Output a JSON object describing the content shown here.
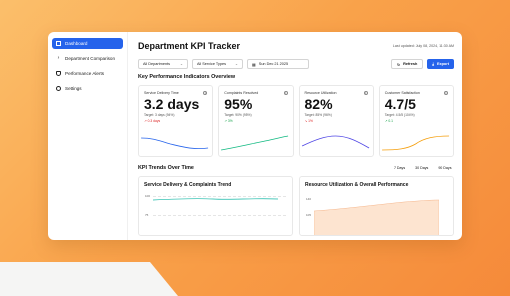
{
  "sidebar": {
    "items": [
      {
        "label": "Dashboard",
        "icon": "grid-icon",
        "active": true
      },
      {
        "label": "Department Comparison",
        "icon": "chevron-right-icon",
        "active": false
      },
      {
        "label": "Performance Alerts",
        "icon": "shield-icon",
        "active": false
      },
      {
        "label": "Settings",
        "icon": "gear-icon",
        "active": false
      }
    ]
  },
  "header": {
    "title": "Department KPI Tracker",
    "last_updated": "Last updated: July 08, 2024, 11:30 AM"
  },
  "filters": {
    "department": "All Departments",
    "service_type": "All Service Types",
    "date": "Sun Dec 21 2025",
    "refresh_label": "Refresh",
    "export_label": "Export"
  },
  "kpi_section_title": "Key Performance Indicators Overview",
  "kpis": [
    {
      "label": "Service Delivery Time",
      "value": "3.2 days",
      "target": "Target: 3 days (94%)",
      "change": "↗ 0.3 days",
      "change_color": "#dc2626",
      "line_color": "#2563eb"
    },
    {
      "label": "Complaints Resolved",
      "value": "95%",
      "target": "Target: 90% (95%)",
      "change": "↗ 3%",
      "change_color": "#16a34a",
      "line_color": "#10b981"
    },
    {
      "label": "Resource Utilization",
      "value": "82%",
      "target": "Target: 85% (96%)",
      "change": "↘ 1%",
      "change_color": "#dc2626",
      "line_color": "#4f46e5"
    },
    {
      "label": "Customer Satisfaction",
      "value": "4.7/5",
      "target": "Target: 4.5/5 (104%)",
      "change": "↗ 0.1",
      "change_color": "#16a34a",
      "line_color": "#f59e0b"
    }
  ],
  "trends": {
    "title": "KPI Trends Over Time",
    "tabs": [
      "7 Days",
      "30 Days",
      "90 Days"
    ]
  },
  "charts": {
    "left_title": "Service Delivery & Complaints Trend",
    "left_ticks": [
      "100",
      "75"
    ],
    "right_title": "Resource Utilization & Overall Performance",
    "right_ticks": [
      "140",
      "105"
    ]
  },
  "colors": {
    "accent": "#2563eb",
    "background_gradient_start": "#fbbf6b",
    "background_gradient_end": "#f58a3a"
  }
}
